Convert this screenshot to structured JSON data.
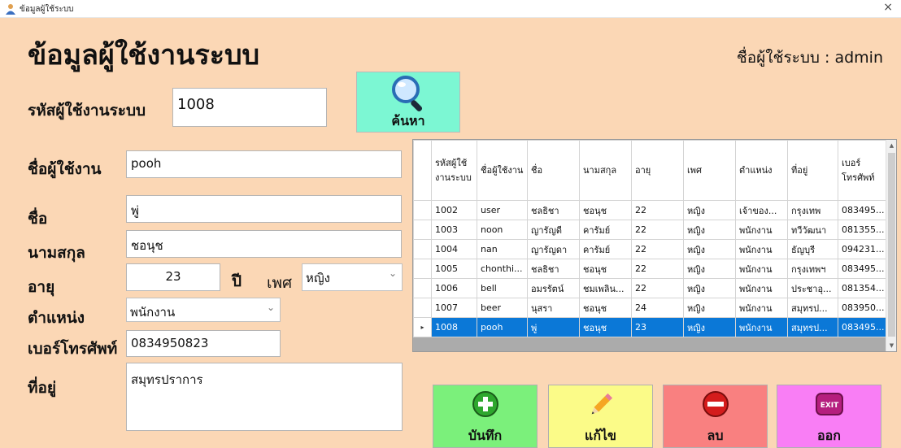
{
  "window": {
    "title": "ข้อมูลผู้ใช้ระบบ",
    "close_label": "×"
  },
  "heading": "ข้อมูลผู้ใช้งานระบบ",
  "logged_in": "ชื่อผู้ใช้ระบบ : admin",
  "search": {
    "label": "รหัสผู้ใช้งานระบบ",
    "value": "1008",
    "button_label": "ค้นหา"
  },
  "form": {
    "username_label": "ชื่อผู้ใช้งาน",
    "username_value": "pooh",
    "firstname_label": "ชื่อ",
    "firstname_value": "พู่",
    "lastname_label": "นามสกุล",
    "lastname_value": "ชอนุช",
    "age_label": "อายุ",
    "age_value": "23",
    "age_unit": "ปี",
    "gender_label": "เพศ",
    "gender_value": "หญิง",
    "position_label": "ตำแหน่ง",
    "position_value": "พนักงาน",
    "phone_label": "เบอร์โทรศัพท์",
    "phone_value": "0834950823",
    "address_label": "ที่อยู่",
    "address_value": "สมุทรปราการ"
  },
  "table": {
    "columns": [
      "รหัสผู้ใช้งานระบบ",
      "ชื่อผู้ใช้งาน",
      "ชื่อ",
      "นามสกุล",
      "อายุ",
      "เพศ",
      "ตำแหน่ง",
      "ที่อยู่",
      "เบอร์โทรศัพท์"
    ],
    "rows": [
      [
        "1002",
        "user",
        "ชลธิชา",
        "ชอนุช",
        "22",
        "หญิง",
        "เจ้าของ...",
        "กรุงเทพ",
        "083495..."
      ],
      [
        "1003",
        "noon",
        "ญารัญดี",
        "คารัมย์",
        "22",
        "หญิง",
        "พนักงาน",
        "ทวีวัฒนา",
        "081355..."
      ],
      [
        "1004",
        "nan",
        "ญารัญดา",
        "คารัมย์",
        "22",
        "หญิง",
        "พนักงาน",
        "ธัญบุรี",
        "094231..."
      ],
      [
        "1005",
        "chonthi...",
        "ชลธิชา",
        "ชอนุช",
        "22",
        "หญิง",
        "พนักงาน",
        "กรุงเทพฯ",
        "083495..."
      ],
      [
        "1006",
        "bell",
        "อมรรัตน์",
        "ชมเพลิน...",
        "22",
        "หญิง",
        "พนักงาน",
        "ประชาอุ...",
        "081354..."
      ],
      [
        "1007",
        "beer",
        "นุสรา",
        "ชอนุช",
        "24",
        "หญิง",
        "พนักงาน",
        "สมุทรป...",
        "083950..."
      ],
      [
        "1008",
        "pooh",
        "พู่",
        "ชอนุช",
        "23",
        "หญิง",
        "พนักงาน",
        "สมุทรป...",
        "083495..."
      ]
    ],
    "selected_row": "1008"
  },
  "buttons": {
    "save": "บันทึก",
    "edit": "แก้ไข",
    "delete": "ลบ",
    "exit": "ออก",
    "exit_icon_text": "EXIT"
  },
  "colors": {
    "background": "#fbd7b5",
    "search_btn": "#7cf7d3",
    "save": "#7bf07b",
    "edit": "#fbfb88",
    "delete": "#f98080",
    "exit": "#f97ef5",
    "selection": "#0b78d7"
  },
  "icons": {
    "search": "magnifier-icon",
    "save": "plus-icon",
    "edit": "pencil-icon",
    "delete": "minus-icon",
    "exit": "exit-icon"
  }
}
